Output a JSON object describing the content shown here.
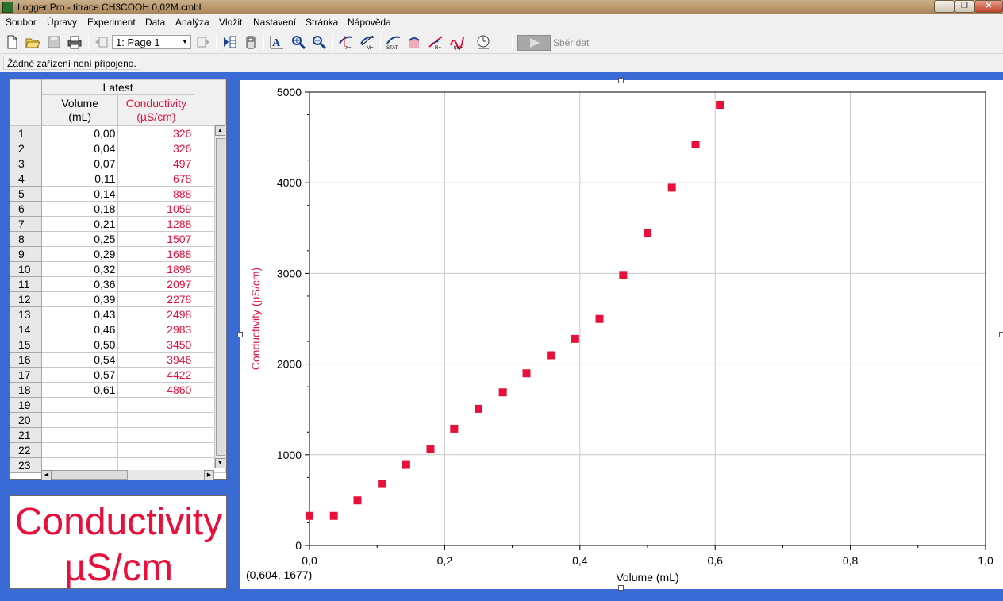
{
  "window": {
    "title": "Logger Pro - titrace CH3COOH 0,02M.cmbl",
    "controls": [
      "minimize",
      "maximize",
      "close"
    ]
  },
  "menu": [
    "Soubor",
    "Úpravy",
    "Experiment",
    "Data",
    "Analýza",
    "Vložit",
    "Nastavení",
    "Stránka",
    "Nápověda"
  ],
  "toolbar": {
    "page_selector": "1: Page 1",
    "collect_label": "Sběr dat",
    "icons": [
      "new-file-icon",
      "open-folder-icon",
      "save-icon",
      "print-icon",
      "previous-page-icon",
      "next-page-icon",
      "table-icon",
      "meter-icon",
      "autoscale-icon",
      "zoom-in-icon",
      "zoom-out-icon",
      "examine-icon",
      "tangent-icon",
      "statistics-icon",
      "integral-icon",
      "linear-fit-icon",
      "curve-fit-icon",
      "replay-icon",
      "collect-icon"
    ]
  },
  "status": {
    "message": "Žádné zařízení není připojeno."
  },
  "table": {
    "dataset": "Latest",
    "columns": [
      {
        "name": "Volume",
        "unit": "(mL)",
        "color": "#000000"
      },
      {
        "name": "Conductivity",
        "unit": "(µS/cm)",
        "color": "#e8103a"
      }
    ],
    "rows": [
      {
        "n": "1",
        "volume": "0,00",
        "conductivity": "326"
      },
      {
        "n": "2",
        "volume": "0,04",
        "conductivity": "326"
      },
      {
        "n": "3",
        "volume": "0,07",
        "conductivity": "497"
      },
      {
        "n": "4",
        "volume": "0,11",
        "conductivity": "678"
      },
      {
        "n": "5",
        "volume": "0,14",
        "conductivity": "888"
      },
      {
        "n": "6",
        "volume": "0,18",
        "conductivity": "1059"
      },
      {
        "n": "7",
        "volume": "0,21",
        "conductivity": "1288"
      },
      {
        "n": "8",
        "volume": "0,25",
        "conductivity": "1507"
      },
      {
        "n": "9",
        "volume": "0,29",
        "conductivity": "1688"
      },
      {
        "n": "10",
        "volume": "0,32",
        "conductivity": "1898"
      },
      {
        "n": "11",
        "volume": "0,36",
        "conductivity": "2097"
      },
      {
        "n": "12",
        "volume": "0,39",
        "conductivity": "2278"
      },
      {
        "n": "13",
        "volume": "0,43",
        "conductivity": "2498"
      },
      {
        "n": "14",
        "volume": "0,46",
        "conductivity": "2983"
      },
      {
        "n": "15",
        "volume": "0,50",
        "conductivity": "3450"
      },
      {
        "n": "16",
        "volume": "0,54",
        "conductivity": "3946"
      },
      {
        "n": "17",
        "volume": "0,57",
        "conductivity": "4422"
      },
      {
        "n": "18",
        "volume": "0,61",
        "conductivity": "4860"
      },
      {
        "n": "19",
        "volume": "",
        "conductivity": ""
      },
      {
        "n": "20",
        "volume": "",
        "conductivity": ""
      },
      {
        "n": "21",
        "volume": "",
        "conductivity": ""
      },
      {
        "n": "22",
        "volume": "",
        "conductivity": ""
      },
      {
        "n": "23",
        "volume": "",
        "conductivity": ""
      }
    ]
  },
  "meter": {
    "name": "Conductivity",
    "unit": "µS/cm",
    "color": "#e8103a"
  },
  "graph": {
    "readout": "(0,604, 1677)"
  },
  "chart_data": {
    "type": "scatter",
    "xlabel": "Volume (mL)",
    "ylabel": "Conductivity (µS/cm)",
    "xlim": [
      0,
      1.0
    ],
    "ylim": [
      0,
      5000
    ],
    "xticks": [
      "0,0",
      "0,2",
      "0,4",
      "0,6",
      "0,8",
      "1,0"
    ],
    "yticks": [
      "0",
      "1000",
      "2000",
      "3000",
      "4000",
      "5000"
    ],
    "grid": true,
    "marker": "square",
    "color": "#e8103a",
    "series": [
      {
        "x": [
          0.0,
          0.036,
          0.071,
          0.107,
          0.143,
          0.179,
          0.214,
          0.25,
          0.286,
          0.321,
          0.357,
          0.393,
          0.429,
          0.464,
          0.5,
          0.536,
          0.571,
          0.607
        ],
        "y": [
          326,
          326,
          497,
          678,
          888,
          1059,
          1288,
          1507,
          1688,
          1898,
          2097,
          2278,
          2498,
          2983,
          3450,
          3946,
          4422,
          4860
        ]
      }
    ]
  }
}
